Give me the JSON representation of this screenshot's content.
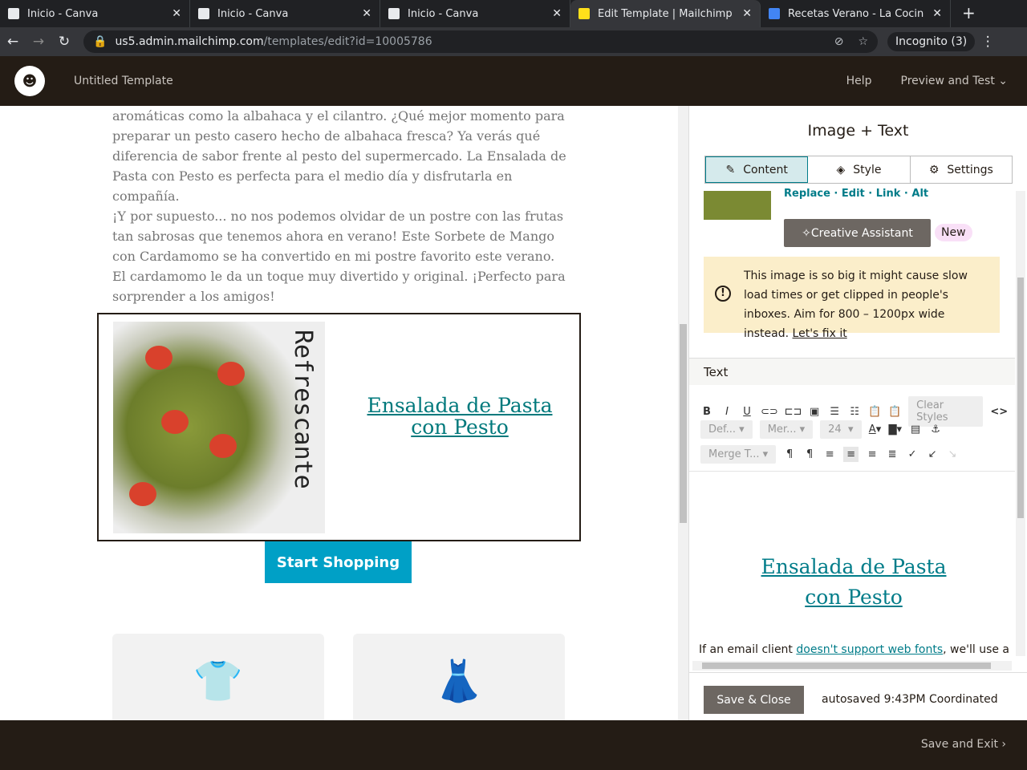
{
  "browser": {
    "tabs": [
      {
        "title": "Inicio - Canva"
      },
      {
        "title": "Inicio - Canva"
      },
      {
        "title": "Inicio - Canva"
      },
      {
        "title": "Edit Template | Mailchimp",
        "active": true
      },
      {
        "title": "Recetas Verano - La Cocina"
      }
    ],
    "url_host": "us5.admin.mailchimp.com",
    "url_path": "/templates/edit?id=10005786",
    "incognito": "Incognito (3)"
  },
  "header": {
    "title": "Untitled Template",
    "help": "Help",
    "preview": "Preview and Test ⌄"
  },
  "email": {
    "para1": "aromáticas como la albahaca y el  cilantro. ¿Qué mejor momento para preparar un pesto casero hecho de albahaca fresca? Ya verás qué diferencia de sabor frente al pesto del supermercado. La Ensalada de Pasta con Pesto es perfecta para el medio día y disfrutarla en compañía.",
    "para2": "¡Y por supuesto... no nos podemos olvidar de un postre con las frutas tan sabrosas que tenemos ahora en verano! Este Sorbete de Mango con Cardamomo se ha convertido en mi postre favorito este verano. El cardamomo le da un toque muy divertido y original. ¡Perfecto para sorprender a los amigos!",
    "image_word": "Refrescante",
    "link": "Ensalada de Pasta con Pesto",
    "button": "Start Shopping"
  },
  "panel": {
    "title": "Image + Text",
    "tabs": [
      "Content",
      "Style",
      "Settings"
    ],
    "actions": [
      "Replace",
      "Edit",
      "Link",
      "Alt"
    ],
    "creative": "Creative Assistant",
    "new_badge": "New",
    "warning": "This image is so big it might cause slow load times or get clipped in people's inboxes. Aim for 800 – 1200px wide instead.",
    "fix": "Let's fix it",
    "text_label": "Text",
    "clear_styles": "Clear Styles",
    "format": "Def...",
    "font": "Mer...",
    "size": "24",
    "merge": "Merge T...",
    "editor_link_1": "Ensalada de Pasta",
    "editor_link_2": "con Pesto",
    "fonts_pre": "If an email client ",
    "fonts_link": "doesn't support web fonts",
    "fonts_post": ", we'll use a",
    "save": "Save & Close",
    "autosaved": "autosaved 9:43PM Coordinated"
  },
  "footer": {
    "exit": "Save and Exit ›"
  }
}
